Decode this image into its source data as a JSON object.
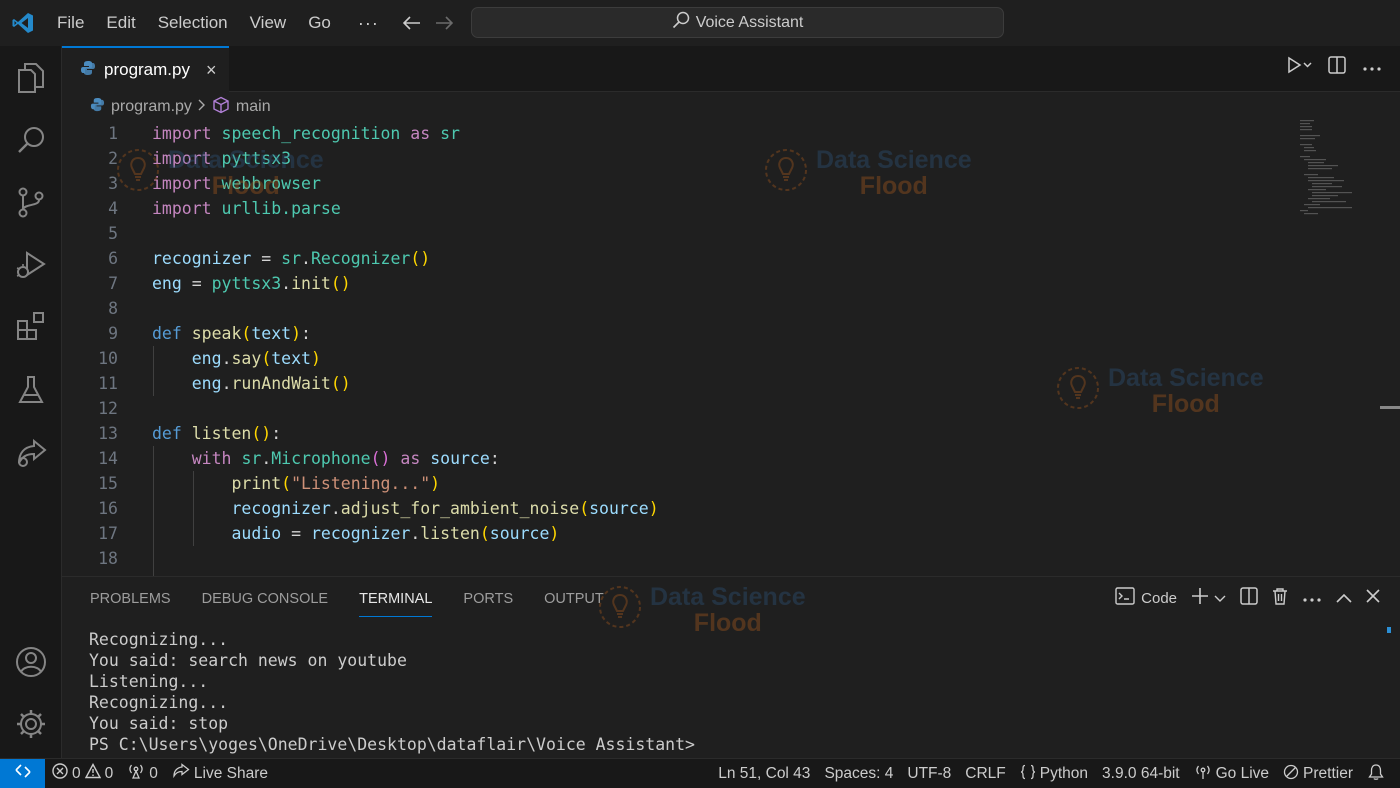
{
  "titlebar": {
    "menu": [
      "File",
      "Edit",
      "Selection",
      "View",
      "Go"
    ],
    "more": "···",
    "command_center": "Voice Assistant"
  },
  "tab": {
    "label": "program.py",
    "close": "×"
  },
  "breadcrumb": {
    "file": "program.py",
    "symbol": "main"
  },
  "code": [
    [
      {
        "t": "import",
        "c": "kw"
      },
      {
        "t": " "
      },
      {
        "t": "speech_recognition",
        "c": "mod"
      },
      {
        "t": " "
      },
      {
        "t": "as",
        "c": "kw"
      },
      {
        "t": " "
      },
      {
        "t": "sr",
        "c": "mod"
      }
    ],
    [
      {
        "t": "import",
        "c": "kw"
      },
      {
        "t": " "
      },
      {
        "t": "pyttsx3",
        "c": "mod"
      }
    ],
    [
      {
        "t": "import",
        "c": "kw"
      },
      {
        "t": " "
      },
      {
        "t": "webbrowser",
        "c": "mod"
      }
    ],
    [
      {
        "t": "import",
        "c": "kw"
      },
      {
        "t": " "
      },
      {
        "t": "urllib.parse",
        "c": "mod"
      }
    ],
    [],
    [
      {
        "t": "recognizer",
        "c": "var"
      },
      {
        "t": " = "
      },
      {
        "t": "sr",
        "c": "mod"
      },
      {
        "t": "."
      },
      {
        "t": "Recognizer",
        "c": "mod"
      },
      {
        "t": "()",
        "c": "par"
      }
    ],
    [
      {
        "t": "eng",
        "c": "var"
      },
      {
        "t": " = "
      },
      {
        "t": "pyttsx3",
        "c": "mod"
      },
      {
        "t": "."
      },
      {
        "t": "init",
        "c": "fn"
      },
      {
        "t": "()",
        "c": "par"
      }
    ],
    [],
    [
      {
        "t": "def",
        "c": "def"
      },
      {
        "t": " "
      },
      {
        "t": "speak",
        "c": "fn"
      },
      {
        "t": "(",
        "c": "par"
      },
      {
        "t": "text",
        "c": "var"
      },
      {
        "t": ")",
        "c": "par"
      },
      {
        "t": ":"
      }
    ],
    [
      {
        "t": "    "
      },
      {
        "t": "eng",
        "c": "var"
      },
      {
        "t": "."
      },
      {
        "t": "say",
        "c": "fn"
      },
      {
        "t": "(",
        "c": "par"
      },
      {
        "t": "text",
        "c": "var"
      },
      {
        "t": ")",
        "c": "par"
      }
    ],
    [
      {
        "t": "    "
      },
      {
        "t": "eng",
        "c": "var"
      },
      {
        "t": "."
      },
      {
        "t": "runAndWait",
        "c": "fn"
      },
      {
        "t": "()",
        "c": "par"
      }
    ],
    [],
    [
      {
        "t": "def",
        "c": "def"
      },
      {
        "t": " "
      },
      {
        "t": "listen",
        "c": "fn"
      },
      {
        "t": "()",
        "c": "par"
      },
      {
        "t": ":"
      }
    ],
    [
      {
        "t": "    "
      },
      {
        "t": "with",
        "c": "kw"
      },
      {
        "t": " "
      },
      {
        "t": "sr",
        "c": "mod"
      },
      {
        "t": "."
      },
      {
        "t": "Microphone",
        "c": "mod"
      },
      {
        "t": "()",
        "c": "par2"
      },
      {
        "t": " "
      },
      {
        "t": "as",
        "c": "kw"
      },
      {
        "t": " "
      },
      {
        "t": "source",
        "c": "var"
      },
      {
        "t": ":"
      }
    ],
    [
      {
        "t": "        "
      },
      {
        "t": "print",
        "c": "fn"
      },
      {
        "t": "(",
        "c": "par"
      },
      {
        "t": "\"Listening...\"",
        "c": "str"
      },
      {
        "t": ")",
        "c": "par"
      }
    ],
    [
      {
        "t": "        "
      },
      {
        "t": "recognizer",
        "c": "var"
      },
      {
        "t": "."
      },
      {
        "t": "adjust_for_ambient_noise",
        "c": "fn"
      },
      {
        "t": "(",
        "c": "par"
      },
      {
        "t": "source",
        "c": "var"
      },
      {
        "t": ")",
        "c": "par"
      }
    ],
    [
      {
        "t": "        "
      },
      {
        "t": "audio",
        "c": "var"
      },
      {
        "t": " = "
      },
      {
        "t": "recognizer",
        "c": "var"
      },
      {
        "t": "."
      },
      {
        "t": "listen",
        "c": "fn"
      },
      {
        "t": "(",
        "c": "par"
      },
      {
        "t": "source",
        "c": "var"
      },
      {
        "t": ")",
        "c": "par"
      }
    ],
    []
  ],
  "watermark": {
    "line1": "Data Science",
    "line2": "Flood"
  },
  "panel": {
    "tabs": [
      "PROBLEMS",
      "DEBUG CONSOLE",
      "TERMINAL",
      "PORTS",
      "OUTPUT"
    ],
    "active_tab": "TERMINAL",
    "terminal_profile": "Code"
  },
  "terminal_lines": [
    "Recognizing...",
    "You said: search news on youtube",
    "Listening...",
    "Recognizing...",
    "You said: stop",
    "PS C:\\Users\\yoges\\OneDrive\\Desktop\\dataflair\\Voice Assistant>"
  ],
  "statusbar": {
    "errors": "0",
    "warnings": "0",
    "ports": "0",
    "live_share": "Live Share",
    "cursor": "Ln 51, Col 43",
    "spaces": "Spaces: 4",
    "encoding": "UTF-8",
    "eol": "CRLF",
    "language": "Python",
    "interpreter": "3.9.0 64-bit",
    "go_live": "Go Live",
    "prettier": "Prettier"
  },
  "colors": {
    "accent": "#0078d4",
    "python_icon": "#4b8bbe"
  }
}
